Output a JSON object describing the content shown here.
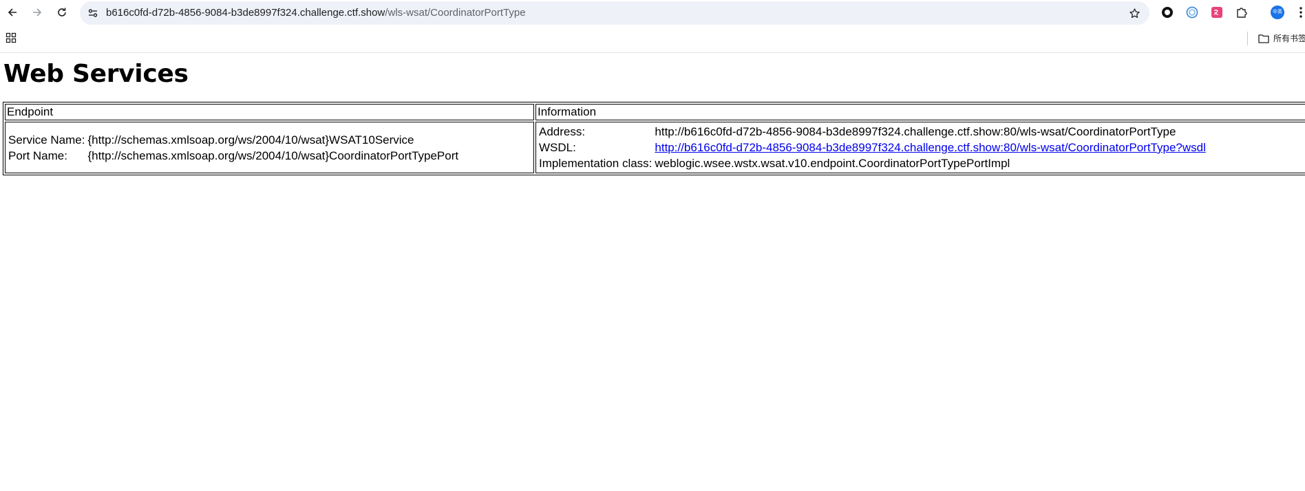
{
  "browser": {
    "url_host": "b616c0fd-d72b-4856-9084-b3de8997f324.challenge.ctf.show",
    "url_path": "/wls-wsat/CoordinatorPortType",
    "all_bookmarks_label": "所有书签",
    "profile_badge": "中英",
    "icons": [
      "back-icon",
      "forward-icon",
      "reload-icon",
      "site-info-icon",
      "star-icon",
      "extension-icon",
      "apps-icon",
      "folder-icon",
      "menu-icon"
    ]
  },
  "page": {
    "title": "Web Services",
    "table": {
      "headers": [
        "Endpoint",
        "Information"
      ],
      "endpoint": {
        "service_label": "Service Name:",
        "service_value": "{http://schemas.xmlsoap.org/ws/2004/10/wsat}WSAT10Service",
        "port_label": "Port Name:",
        "port_value": "{http://schemas.xmlsoap.org/ws/2004/10/wsat}CoordinatorPortTypePort"
      },
      "information": {
        "address_label": "Address:",
        "address_value": "http://b616c0fd-d72b-4856-9084-b3de8997f324.challenge.ctf.show:80/wls-wsat/CoordinatorPortType",
        "wsdl_label": "WSDL:",
        "wsdl_value": "http://b616c0fd-d72b-4856-9084-b3de8997f324.challenge.ctf.show:80/wls-wsat/CoordinatorPortType?wsdl",
        "impl_label": "Implementation class:",
        "impl_value": "weblogic.wsee.wstx.wsat.v10.endpoint.CoordinatorPortTypePortImpl"
      }
    }
  },
  "colors": {
    "link": "#0000ee",
    "omnibox_bg": "#eef1f8",
    "profile_badge": "#1a73e8"
  }
}
